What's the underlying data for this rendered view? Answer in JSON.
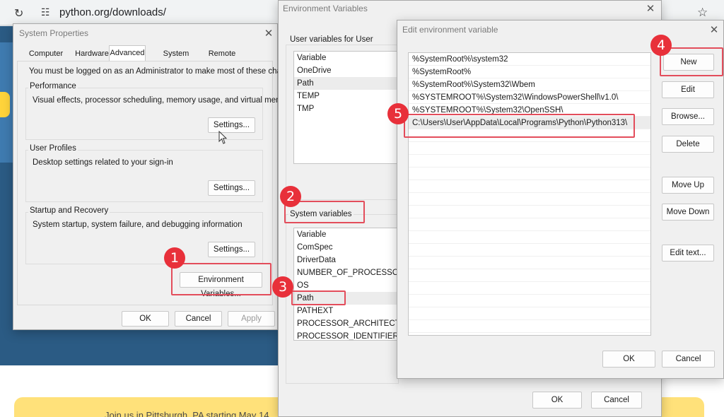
{
  "browser": {
    "url": "python.org/downloads/",
    "banner_text": "Join us in Pittsburgh, PA starting May 14"
  },
  "system_properties": {
    "title": "System Properties",
    "tabs": [
      {
        "label": "Computer Name"
      },
      {
        "label": "Hardware"
      },
      {
        "label": "Advanced",
        "active": true
      },
      {
        "label": "System Protection"
      },
      {
        "label": "Remote"
      }
    ],
    "admin_note": "You must be logged on as an Administrator to make most of these changes.",
    "performance": {
      "label": "Performance",
      "description": "Visual effects, processor scheduling, memory usage, and virtual memory",
      "button": "Settings..."
    },
    "user_profiles": {
      "label": "User Profiles",
      "description": "Desktop settings related to your sign-in",
      "button": "Settings..."
    },
    "startup_recovery": {
      "label": "Startup and Recovery",
      "description": "System startup, system failure, and debugging information",
      "button": "Settings..."
    },
    "env_button": "Environment Variables...",
    "ok": "OK",
    "cancel": "Cancel",
    "apply": "Apply"
  },
  "env_vars": {
    "title": "Environment Variables",
    "user_label": "User variables for User",
    "user_header": "Variable",
    "user_vars": [
      "OneDrive",
      "Path",
      "TEMP",
      "TMP"
    ],
    "user_selected": 1,
    "system_label": "System variables",
    "system_header": "Variable",
    "system_vars": [
      "ComSpec",
      "DriverData",
      "NUMBER_OF_PROCESSORS",
      "OS",
      "Path",
      "PATHEXT",
      "PROCESSOR_ARCHITECTURE",
      "PROCESSOR_IDENTIFIER"
    ],
    "system_selected": 4,
    "ok": "OK",
    "cancel": "Cancel"
  },
  "edit_env": {
    "title": "Edit environment variable",
    "entries": [
      "%SystemRoot%\\system32",
      "%SystemRoot%",
      "%SystemRoot%\\System32\\Wbem",
      "%SYSTEMROOT%\\System32\\WindowsPowerShell\\v1.0\\",
      "%SYSTEMROOT%\\System32\\OpenSSH\\",
      "C:\\Users\\User\\AppData\\Local\\Programs\\Python\\Python313\\"
    ],
    "selected": 5,
    "buttons": {
      "new": "New",
      "edit": "Edit",
      "browse": "Browse...",
      "delete": "Delete",
      "move_up": "Move Up",
      "move_down": "Move Down",
      "edit_text": "Edit text..."
    },
    "ok": "OK",
    "cancel": "Cancel"
  },
  "annotations": [
    "1",
    "2",
    "3",
    "4",
    "5"
  ]
}
